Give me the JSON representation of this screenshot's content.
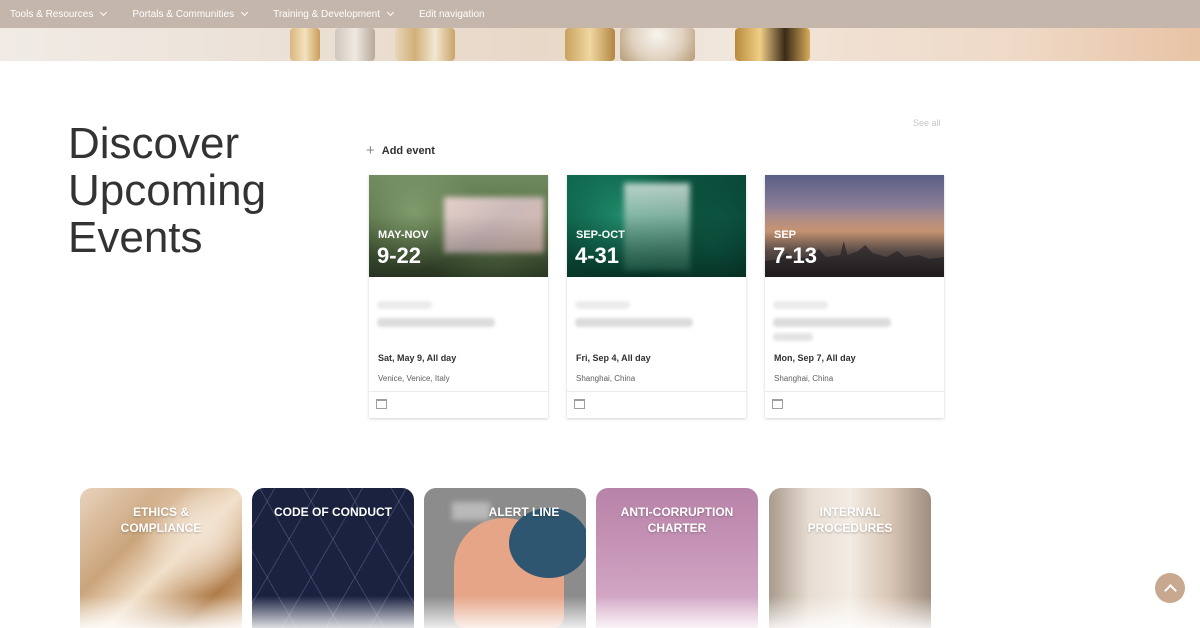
{
  "nav": {
    "items": [
      {
        "label": "Tools & Resources",
        "has_dropdown": true
      },
      {
        "label": "Portals & Communities",
        "has_dropdown": true
      },
      {
        "label": "Training & Development",
        "has_dropdown": true
      },
      {
        "label": "Edit navigation",
        "has_dropdown": false
      }
    ]
  },
  "events_section": {
    "title": "Discover Upcoming Events",
    "add_event_label": "Add event",
    "see_all_label": "See all",
    "events": [
      {
        "range": "MAY-NOV",
        "days": "9-22",
        "date": "Sat, May 9, All day",
        "location": "Venice, Venice, Italy"
      },
      {
        "range": "SEP-OCT",
        "days": "4-31",
        "date": "Fri, Sep 4, All day",
        "location": "Shanghai, China"
      },
      {
        "range": "SEP",
        "days": "7-13",
        "date": "Mon, Sep 7, All day",
        "location": "Shanghai, China"
      }
    ]
  },
  "tiles": [
    {
      "label": "ETHICS & COMPLIANCE"
    },
    {
      "label": "CODE OF CONDUCT"
    },
    {
      "label": "ALERT LINE"
    },
    {
      "label": "ANTI-CORRUPTION CHARTER"
    },
    {
      "label": "INTERNAL PROCEDURES"
    }
  ],
  "icons": {
    "dropdown": "chevron-down-icon",
    "add": "plus-icon",
    "calendar": "calendar-icon",
    "scroll_top": "chevron-up-icon"
  },
  "colors": {
    "nav_bg": "#c4b6ab",
    "scroll_top_bg": "#c8a88f"
  }
}
